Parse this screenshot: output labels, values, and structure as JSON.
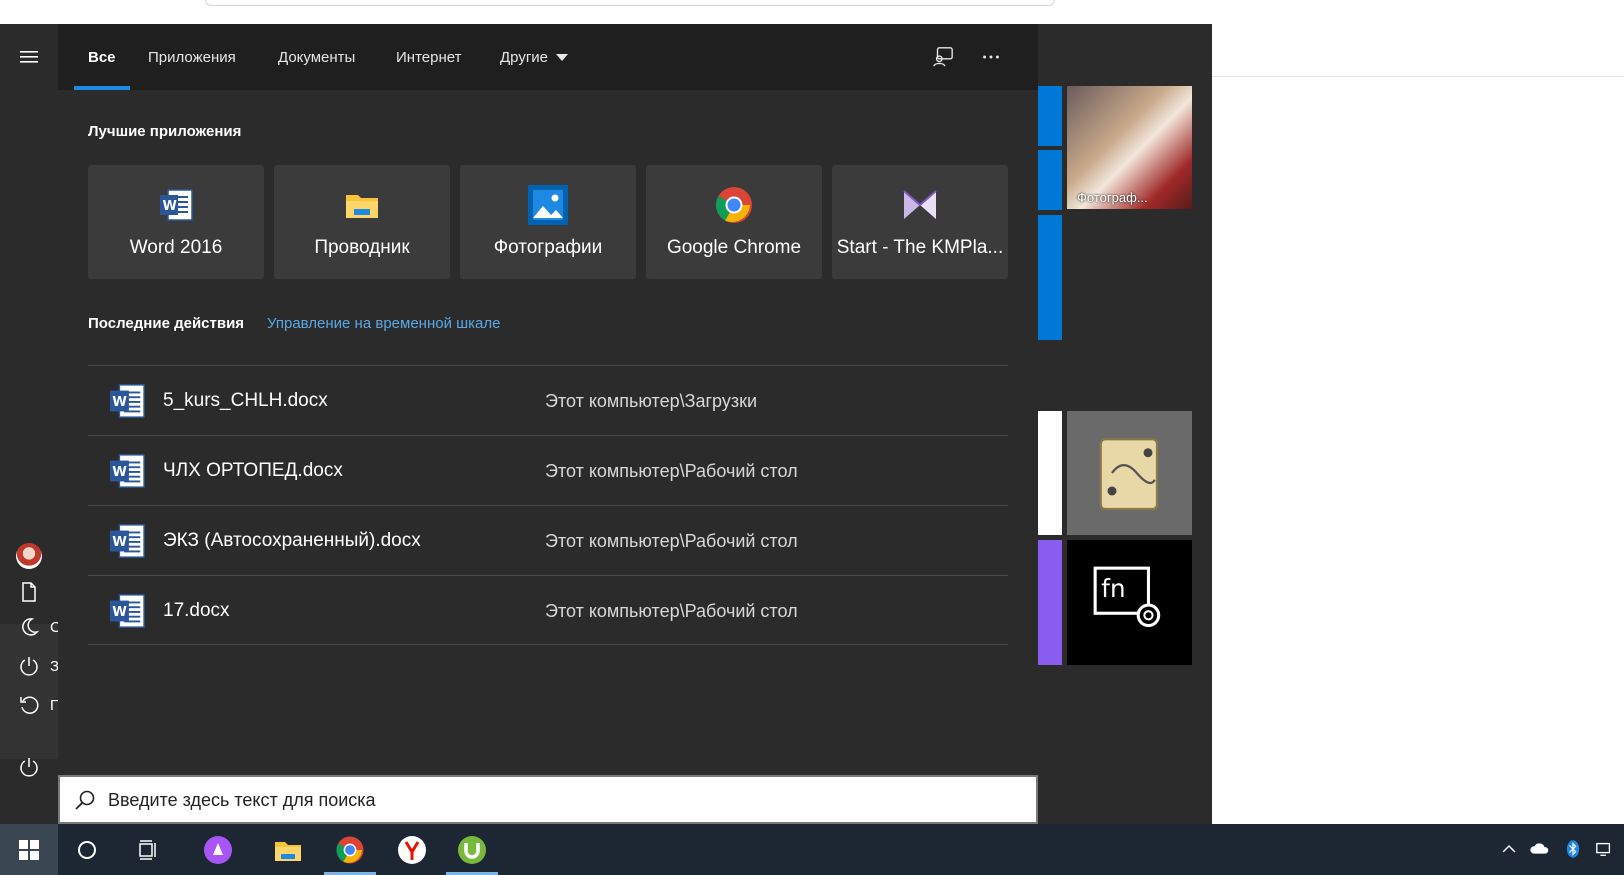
{
  "tabs": [
    {
      "label": "Все",
      "active": true
    },
    {
      "label": "Приложения"
    },
    {
      "label": "Документы"
    },
    {
      "label": "Интернет"
    },
    {
      "label": "Другие"
    }
  ],
  "sections": {
    "top_apps": "Лучшие приложения",
    "recent": "Последние действия",
    "timeline_link": "Управление на временной шкале"
  },
  "top_apps": [
    {
      "label": "Word 2016",
      "icon": "word-icon"
    },
    {
      "label": "Проводник",
      "icon": "file-explorer-icon"
    },
    {
      "label": "Фотографии",
      "icon": "photos-icon"
    },
    {
      "label": "Google Chrome",
      "icon": "chrome-icon"
    },
    {
      "label": "Start - The KMPla...",
      "icon": "kmplayer-icon"
    }
  ],
  "recent": [
    {
      "name": "5_kurs_CHLH.docx",
      "path": "Этот компьютер\\Загрузки"
    },
    {
      "name": "ЧЛХ ОРТОПЕД.docx",
      "path": "Этот компьютер\\Рабочий стол"
    },
    {
      "name": "ЭКЗ (Автосохраненный).docx",
      "path": "Этот компьютер\\Рабочий стол"
    },
    {
      "name": "17.docx",
      "path": "Этот компьютер\\Рабочий стол"
    }
  ],
  "search": {
    "placeholder": "Введите здесь текст для поиска"
  },
  "tiles": {
    "photos_label": "Фотограф..."
  },
  "strip_letters": [
    "С",
    "З",
    "П"
  ],
  "colors": {
    "accent": "#1e88e5",
    "link": "#5aa9e6",
    "panel": "#2b2b2b"
  }
}
